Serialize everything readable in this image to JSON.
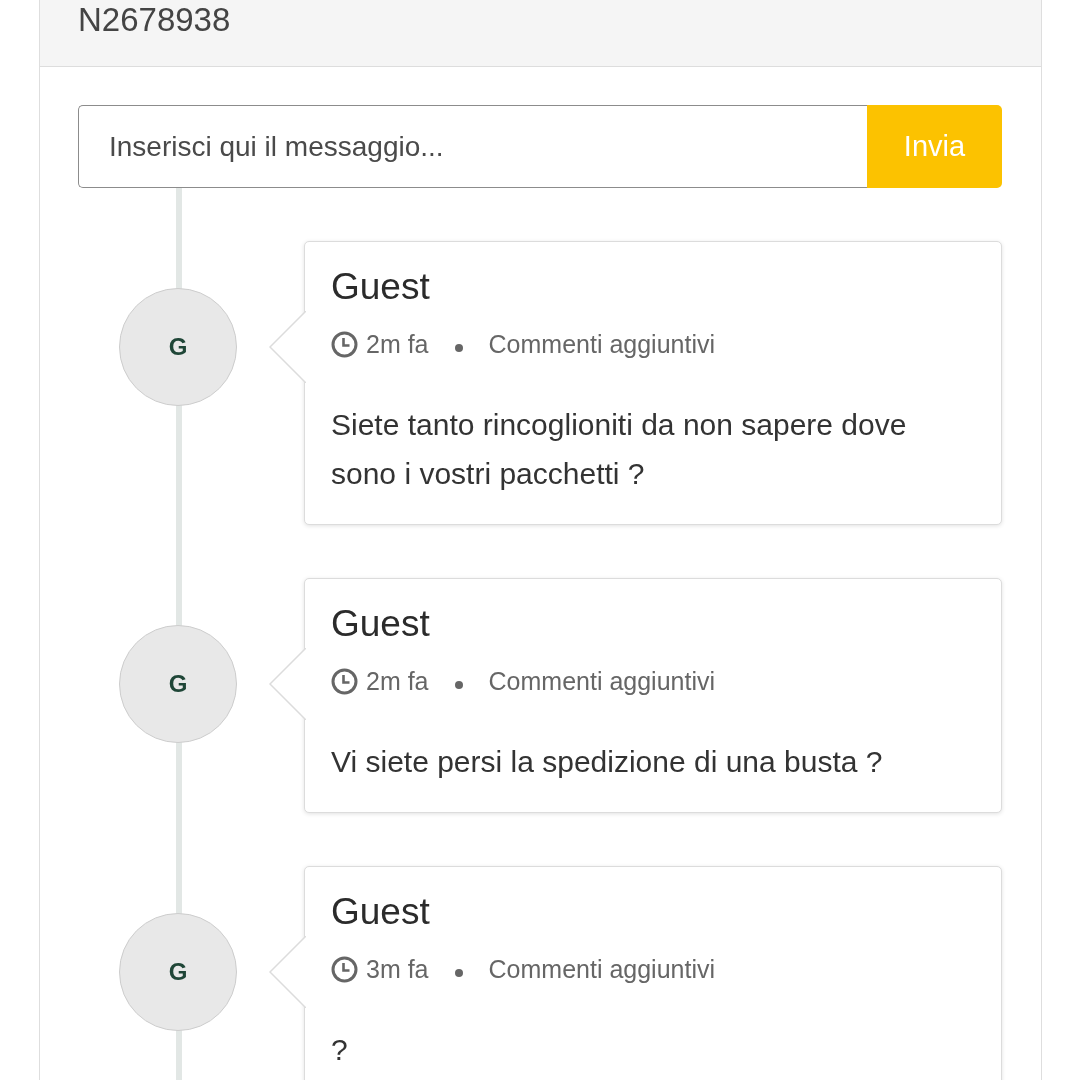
{
  "header": {
    "title": "N2678938"
  },
  "composer": {
    "placeholder": "Inserisci qui il messaggio...",
    "button": "Invia"
  },
  "comments": [
    {
      "avatar": "G",
      "author": "Guest",
      "time": "2m fa",
      "category": "Commenti aggiuntivi",
      "message": "Siete tanto rincoglioniti da non sapere dove sono i vostri pacchetti ?"
    },
    {
      "avatar": "G",
      "author": "Guest",
      "time": "2m fa",
      "category": "Commenti aggiuntivi",
      "message": "Vi siete persi la spedizione di una busta ?"
    },
    {
      "avatar": "G",
      "author": "Guest",
      "time": "3m fa",
      "category": "Commenti aggiuntivi",
      "message": "?"
    }
  ]
}
